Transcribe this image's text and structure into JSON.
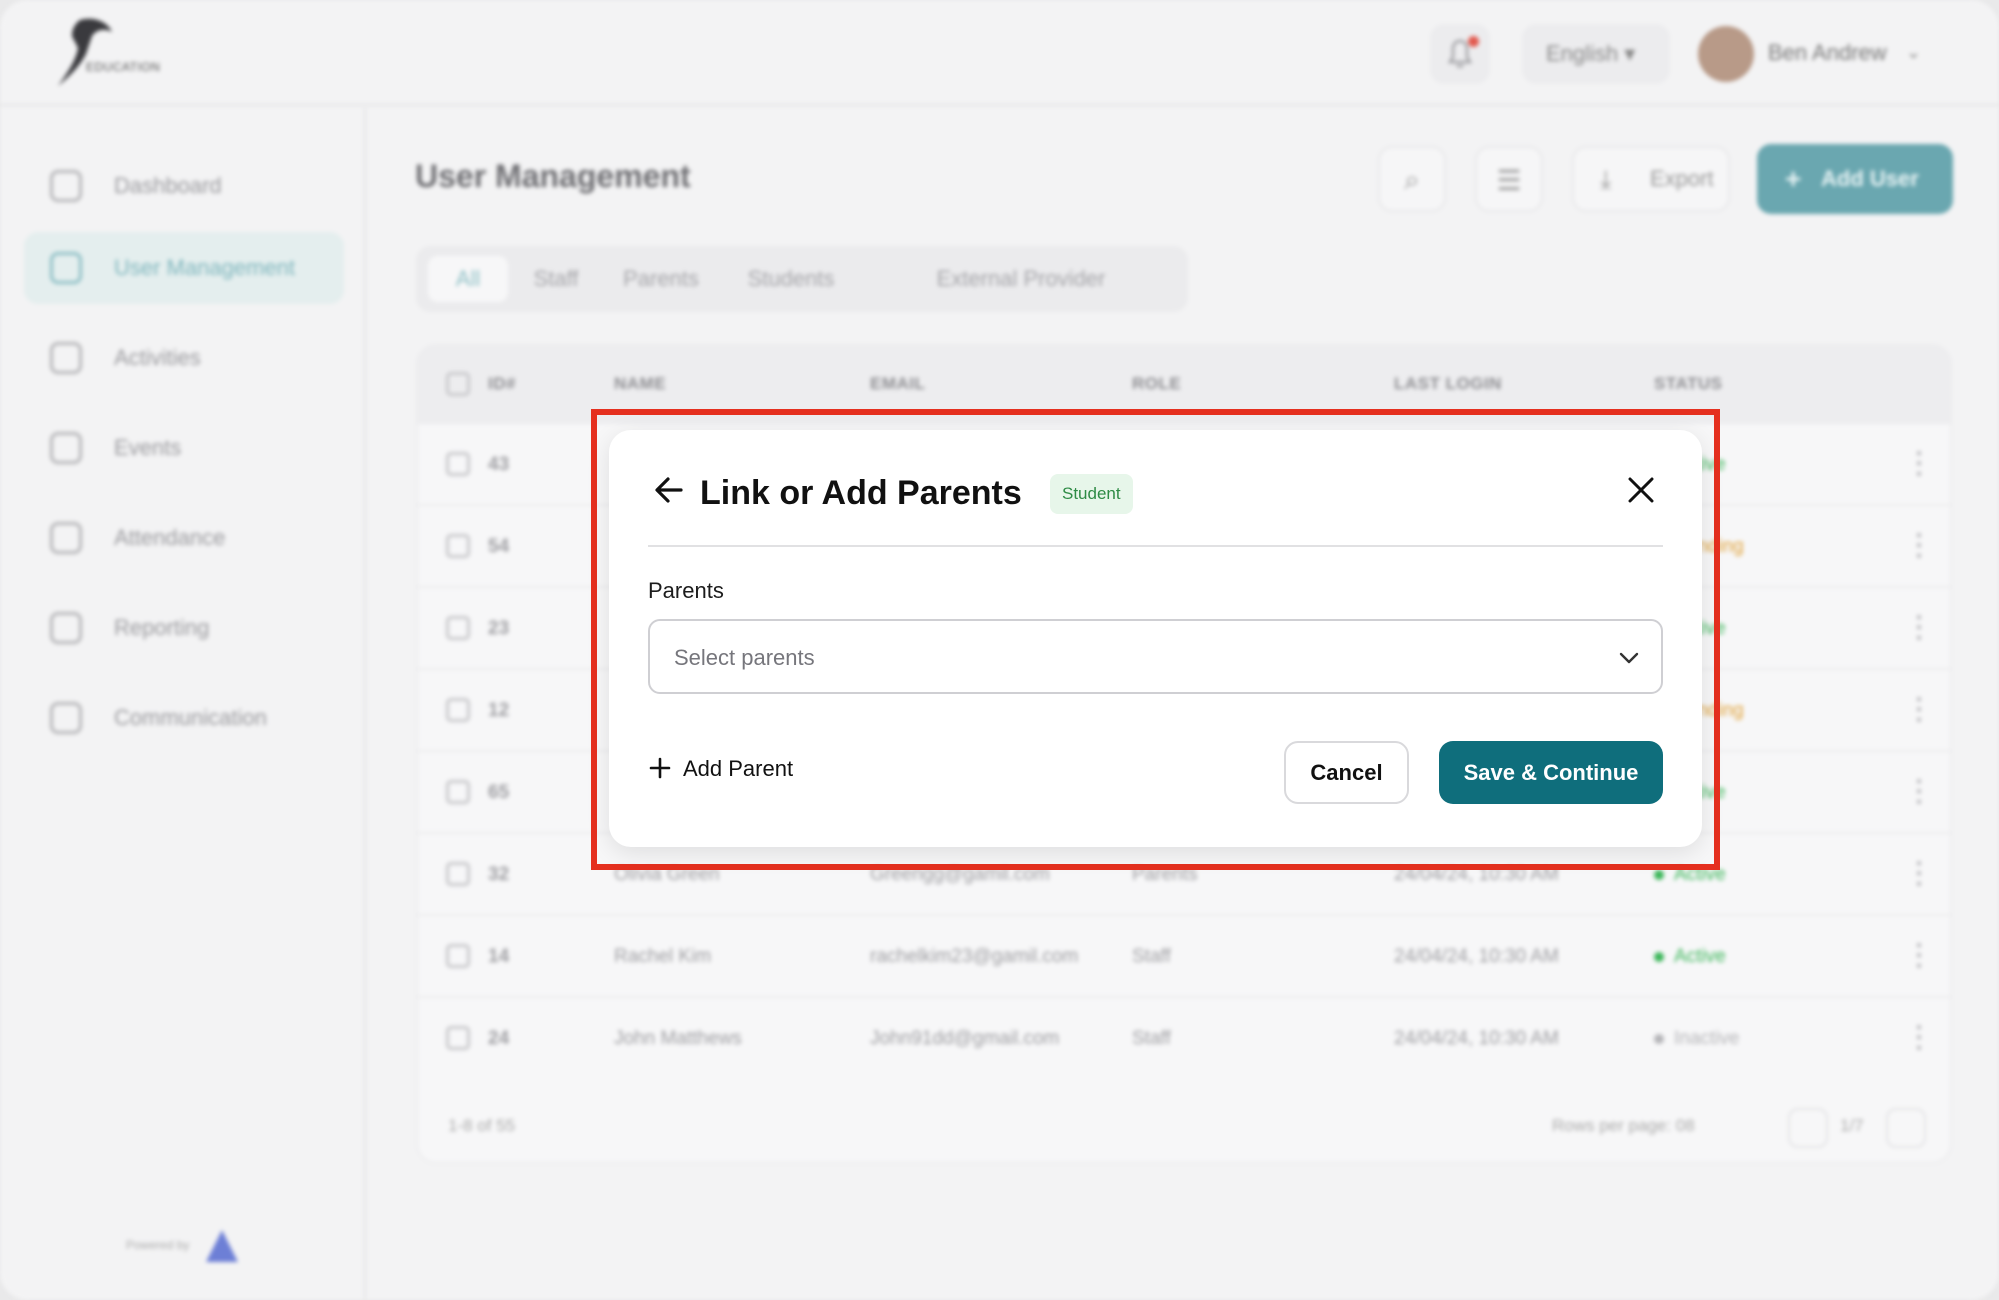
{
  "header": {
    "logo_text": "EDUCATION",
    "language": "English",
    "user_name": "Ben Andrew"
  },
  "sidebar": {
    "items": [
      {
        "label": "Dashboard",
        "icon": "grid-icon"
      },
      {
        "label": "User Management",
        "icon": "users-icon",
        "active": true
      },
      {
        "label": "Activities",
        "icon": "activities-icon"
      },
      {
        "label": "Events",
        "icon": "calendar-icon"
      },
      {
        "label": "Attendance",
        "icon": "attendance-icon"
      },
      {
        "label": "Reporting",
        "icon": "bar-chart-icon"
      },
      {
        "label": "Communication",
        "icon": "chat-icon"
      }
    ],
    "powered_by": "Powered by"
  },
  "main": {
    "title": "User Management",
    "export_label": "Export",
    "add_user_label": "Add User",
    "tabs": [
      "All",
      "Staff",
      "Parents",
      "Students",
      "External Provider"
    ],
    "active_tab": "All",
    "table": {
      "columns": [
        "ID#",
        "NAME",
        "EMAIL",
        "ROLE",
        "LAST LOGIN",
        "STATUS"
      ],
      "rows": [
        {
          "id": "43",
          "name": "",
          "email": "",
          "role": "",
          "last_login": "",
          "status": "Active"
        },
        {
          "id": "54",
          "name": "",
          "email": "",
          "role": "",
          "last_login": "",
          "status": "Pending"
        },
        {
          "id": "23",
          "name": "",
          "email": "",
          "role": "",
          "last_login": "",
          "status": "Active"
        },
        {
          "id": "12",
          "name": "",
          "email": "",
          "role": "",
          "last_login": "",
          "status": "Pending"
        },
        {
          "id": "65",
          "name": "",
          "email": "",
          "role": "",
          "last_login": "",
          "status": "Active"
        },
        {
          "id": "32",
          "name": "Olivia Green",
          "email": "Greengg@gamil.com",
          "role": "Parents",
          "last_login": "24/04/24, 10:30 AM",
          "status": "Active"
        },
        {
          "id": "14",
          "name": "Rachel Kim",
          "email": "rachelkim23@gamil.com",
          "role": "Staff",
          "last_login": "24/04/24, 10:30 AM",
          "status": "Active"
        },
        {
          "id": "24",
          "name": "John Matthews",
          "email": "John91dd@gmail.com",
          "role": "Staff",
          "last_login": "24/04/24, 10:30 AM",
          "status": "Inactive"
        }
      ],
      "range_text": "1-8 of 55",
      "rows_per_page_text": "Rows per page: 08",
      "page_text": "1/7"
    }
  },
  "modal": {
    "title": "Link or Add Parents",
    "badge": "Student",
    "field_label": "Parents",
    "select_placeholder": "Select parents",
    "add_parent_label": "Add Parent",
    "cancel_label": "Cancel",
    "save_label": "Save & Continue"
  },
  "colors": {
    "primary": "#0f6e7c",
    "highlight": "#e5301f",
    "badge_bg": "#e7f6ea",
    "badge_text": "#2e8b45",
    "status_active": "#3cb65a",
    "status_pending": "#e0a23a",
    "status_inactive": "#b5b5b8"
  }
}
